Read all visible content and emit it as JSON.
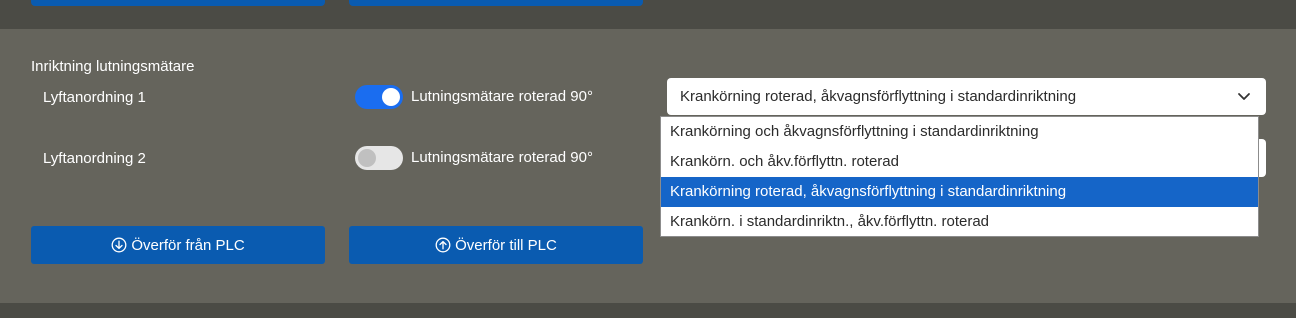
{
  "section": {
    "title": "Inriktning lutningsmätare"
  },
  "rows": [
    {
      "label": "Lyftanordning 1",
      "toggle_label": "Lutningsmätare roterad 90°",
      "toggle_on": true
    },
    {
      "label": "Lyftanordning 2",
      "toggle_label": "Lutningsmätare roterad 90°",
      "toggle_on": false
    }
  ],
  "select": {
    "value": "Krankörning roterad, åkvagnsförflyttning i standardinriktning",
    "options": [
      "Krankörning och åkvagnsförflyttning i standardinriktning",
      "Krankörn. och åkv.förflyttn. roterad",
      "Krankörning roterad, åkvagnsförflyttning i standardinriktning",
      "Krankörn. i standardinriktn., åkv.förflyttn. roterad"
    ],
    "selected_index": 2
  },
  "buttons": {
    "from_plc": "Överför från PLC",
    "to_plc": "Överför till PLC"
  },
  "icons": {
    "from_plc": "arrow-down-circle-icon",
    "to_plc": "arrow-up-circle-icon",
    "dropdown": "chevron-down-icon"
  },
  "colors": {
    "accent": "#0a5bb0",
    "toggle_on": "#1a6df0",
    "option_selected": "#1565c8",
    "panel": "#65645c"
  }
}
